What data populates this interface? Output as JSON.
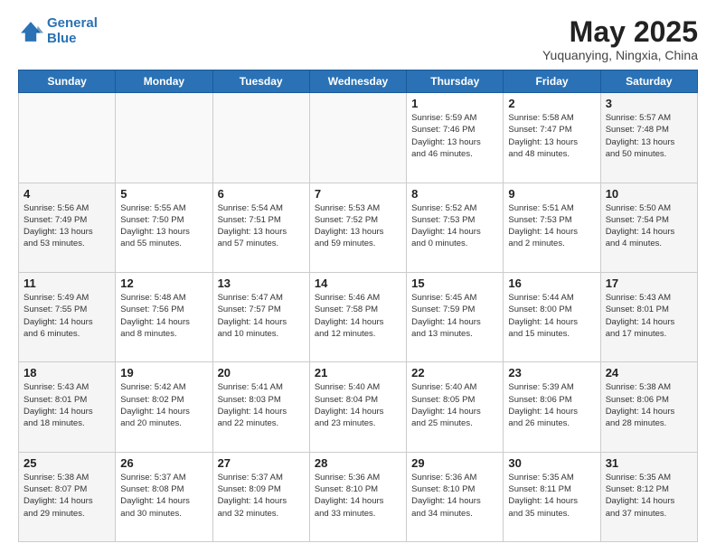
{
  "header": {
    "logo_line1": "General",
    "logo_line2": "Blue",
    "month_year": "May 2025",
    "location": "Yuquanying, Ningxia, China"
  },
  "weekdays": [
    "Sunday",
    "Monday",
    "Tuesday",
    "Wednesday",
    "Thursday",
    "Friday",
    "Saturday"
  ],
  "weeks": [
    [
      {
        "day": "",
        "info": ""
      },
      {
        "day": "",
        "info": ""
      },
      {
        "day": "",
        "info": ""
      },
      {
        "day": "",
        "info": ""
      },
      {
        "day": "1",
        "info": "Sunrise: 5:59 AM\nSunset: 7:46 PM\nDaylight: 13 hours\nand 46 minutes."
      },
      {
        "day": "2",
        "info": "Sunrise: 5:58 AM\nSunset: 7:47 PM\nDaylight: 13 hours\nand 48 minutes."
      },
      {
        "day": "3",
        "info": "Sunrise: 5:57 AM\nSunset: 7:48 PM\nDaylight: 13 hours\nand 50 minutes."
      }
    ],
    [
      {
        "day": "4",
        "info": "Sunrise: 5:56 AM\nSunset: 7:49 PM\nDaylight: 13 hours\nand 53 minutes."
      },
      {
        "day": "5",
        "info": "Sunrise: 5:55 AM\nSunset: 7:50 PM\nDaylight: 13 hours\nand 55 minutes."
      },
      {
        "day": "6",
        "info": "Sunrise: 5:54 AM\nSunset: 7:51 PM\nDaylight: 13 hours\nand 57 minutes."
      },
      {
        "day": "7",
        "info": "Sunrise: 5:53 AM\nSunset: 7:52 PM\nDaylight: 13 hours\nand 59 minutes."
      },
      {
        "day": "8",
        "info": "Sunrise: 5:52 AM\nSunset: 7:53 PM\nDaylight: 14 hours\nand 0 minutes."
      },
      {
        "day": "9",
        "info": "Sunrise: 5:51 AM\nSunset: 7:53 PM\nDaylight: 14 hours\nand 2 minutes."
      },
      {
        "day": "10",
        "info": "Sunrise: 5:50 AM\nSunset: 7:54 PM\nDaylight: 14 hours\nand 4 minutes."
      }
    ],
    [
      {
        "day": "11",
        "info": "Sunrise: 5:49 AM\nSunset: 7:55 PM\nDaylight: 14 hours\nand 6 minutes."
      },
      {
        "day": "12",
        "info": "Sunrise: 5:48 AM\nSunset: 7:56 PM\nDaylight: 14 hours\nand 8 minutes."
      },
      {
        "day": "13",
        "info": "Sunrise: 5:47 AM\nSunset: 7:57 PM\nDaylight: 14 hours\nand 10 minutes."
      },
      {
        "day": "14",
        "info": "Sunrise: 5:46 AM\nSunset: 7:58 PM\nDaylight: 14 hours\nand 12 minutes."
      },
      {
        "day": "15",
        "info": "Sunrise: 5:45 AM\nSunset: 7:59 PM\nDaylight: 14 hours\nand 13 minutes."
      },
      {
        "day": "16",
        "info": "Sunrise: 5:44 AM\nSunset: 8:00 PM\nDaylight: 14 hours\nand 15 minutes."
      },
      {
        "day": "17",
        "info": "Sunrise: 5:43 AM\nSunset: 8:01 PM\nDaylight: 14 hours\nand 17 minutes."
      }
    ],
    [
      {
        "day": "18",
        "info": "Sunrise: 5:43 AM\nSunset: 8:01 PM\nDaylight: 14 hours\nand 18 minutes."
      },
      {
        "day": "19",
        "info": "Sunrise: 5:42 AM\nSunset: 8:02 PM\nDaylight: 14 hours\nand 20 minutes."
      },
      {
        "day": "20",
        "info": "Sunrise: 5:41 AM\nSunset: 8:03 PM\nDaylight: 14 hours\nand 22 minutes."
      },
      {
        "day": "21",
        "info": "Sunrise: 5:40 AM\nSunset: 8:04 PM\nDaylight: 14 hours\nand 23 minutes."
      },
      {
        "day": "22",
        "info": "Sunrise: 5:40 AM\nSunset: 8:05 PM\nDaylight: 14 hours\nand 25 minutes."
      },
      {
        "day": "23",
        "info": "Sunrise: 5:39 AM\nSunset: 8:06 PM\nDaylight: 14 hours\nand 26 minutes."
      },
      {
        "day": "24",
        "info": "Sunrise: 5:38 AM\nSunset: 8:06 PM\nDaylight: 14 hours\nand 28 minutes."
      }
    ],
    [
      {
        "day": "25",
        "info": "Sunrise: 5:38 AM\nSunset: 8:07 PM\nDaylight: 14 hours\nand 29 minutes."
      },
      {
        "day": "26",
        "info": "Sunrise: 5:37 AM\nSunset: 8:08 PM\nDaylight: 14 hours\nand 30 minutes."
      },
      {
        "day": "27",
        "info": "Sunrise: 5:37 AM\nSunset: 8:09 PM\nDaylight: 14 hours\nand 32 minutes."
      },
      {
        "day": "28",
        "info": "Sunrise: 5:36 AM\nSunset: 8:10 PM\nDaylight: 14 hours\nand 33 minutes."
      },
      {
        "day": "29",
        "info": "Sunrise: 5:36 AM\nSunset: 8:10 PM\nDaylight: 14 hours\nand 34 minutes."
      },
      {
        "day": "30",
        "info": "Sunrise: 5:35 AM\nSunset: 8:11 PM\nDaylight: 14 hours\nand 35 minutes."
      },
      {
        "day": "31",
        "info": "Sunrise: 5:35 AM\nSunset: 8:12 PM\nDaylight: 14 hours\nand 37 minutes."
      }
    ]
  ]
}
